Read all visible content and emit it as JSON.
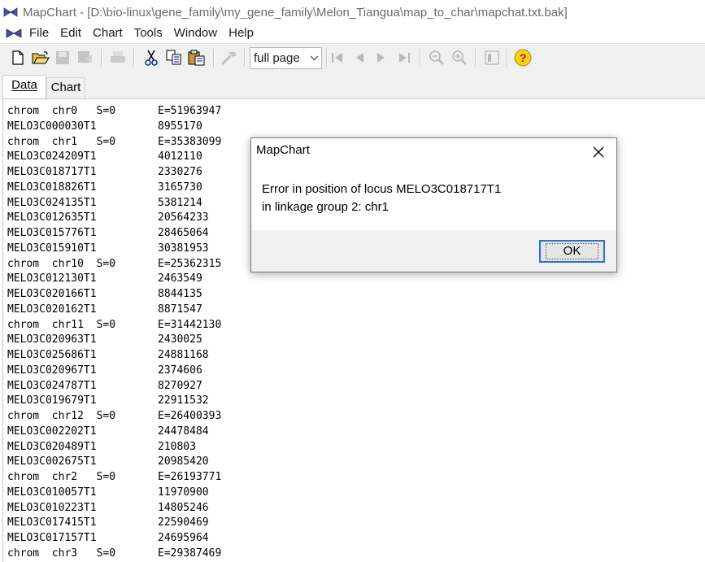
{
  "window": {
    "title": "MapChart - [D:\\bio-linux\\gene_family\\my_gene_family\\Melon_Tiangua\\map_to_char\\mapchat.txt.bak]"
  },
  "menu": {
    "items": [
      "File",
      "Edit",
      "Chart",
      "Tools",
      "Window",
      "Help"
    ]
  },
  "toolbar": {
    "zoom_value": "full page",
    "icons": [
      "new-file-icon",
      "open-folder-icon",
      "save-icon",
      "save-as-icon",
      "print-icon",
      "cut-icon",
      "copy-icon",
      "paste-icon",
      "tools-icon",
      "first-page-icon",
      "prev-page-icon",
      "next-page-icon",
      "last-page-icon",
      "zoom-out-icon",
      "zoom-in-icon",
      "page-icon",
      "help-icon"
    ]
  },
  "tabs": {
    "data": "Data",
    "chart": "Chart"
  },
  "data_lines": [
    [
      "chrom  chr0   S=0",
      "E=51963947"
    ],
    [
      "MELO3C000030T1",
      "8955170"
    ],
    [
      "chrom  chr1   S=0",
      "E=35383099"
    ],
    [
      "MELO3C024209T1",
      "4012110"
    ],
    [
      "MELO3C018717T1",
      "2330276"
    ],
    [
      "MELO3C018826T1",
      "3165730"
    ],
    [
      "MELO3C024135T1",
      "5381214"
    ],
    [
      "MELO3C012635T1",
      "20564233"
    ],
    [
      "MELO3C015776T1",
      "28465064"
    ],
    [
      "MELO3C015910T1",
      "30381953"
    ],
    [
      "chrom  chr10  S=0",
      "E=25362315"
    ],
    [
      "MELO3C012130T1",
      "2463549"
    ],
    [
      "MELO3C020166T1",
      "8844135"
    ],
    [
      "MELO3C020162T1",
      "8871547"
    ],
    [
      "chrom  chr11  S=0",
      "E=31442130"
    ],
    [
      "MELO3C020963T1",
      "2430025"
    ],
    [
      "MELO3C025686T1",
      "24881168"
    ],
    [
      "MELO3C020967T1",
      "2374606"
    ],
    [
      "MELO3C024787T1",
      "8270927"
    ],
    [
      "MELO3C019679T1",
      "22911532"
    ],
    [
      "chrom  chr12  S=0",
      "E=26400393"
    ],
    [
      "MELO3C002202T1",
      "24478484"
    ],
    [
      "MELO3C020489T1",
      "210803"
    ],
    [
      "MELO3C002675T1",
      "20985420"
    ],
    [
      "chrom  chr2   S=0",
      "E=26193771"
    ],
    [
      "MELO3C010057T1",
      "11970900"
    ],
    [
      "MELO3C010223T1",
      "14805246"
    ],
    [
      "MELO3C017415T1",
      "22590469"
    ],
    [
      "MELO3C017157T1",
      "24695964"
    ],
    [
      "chrom  chr3   S=0",
      "E=29387469"
    ]
  ],
  "dialog": {
    "title": "MapChart",
    "line1": "Error in position of locus MELO3C018717T1",
    "line2": "in linkage group 2: chr1",
    "ok": "OK"
  },
  "colors": {
    "ok_border": "#2b6fd1",
    "help_icon": "#f5d21c"
  }
}
